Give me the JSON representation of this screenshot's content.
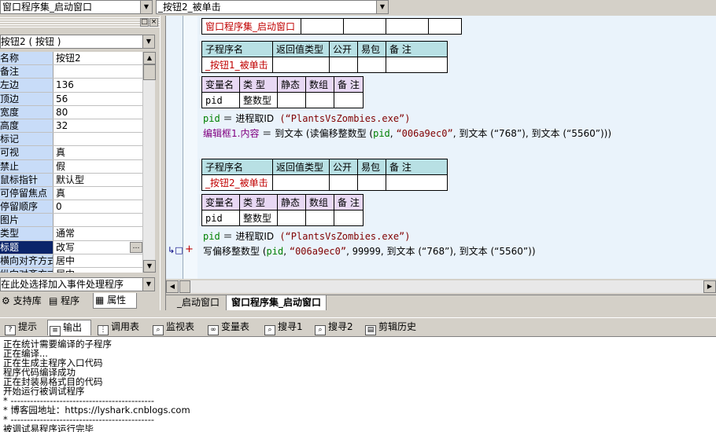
{
  "top": {
    "class_combo": "窗口程序集_启动窗口",
    "sub_combo": "_按钮2_被单击"
  },
  "left": {
    "object_combo": "按钮2 ( 按钮 )",
    "props": [
      {
        "name": "名称",
        "value": "按钮2"
      },
      {
        "name": "备注",
        "value": ""
      },
      {
        "name": "左边",
        "value": "136"
      },
      {
        "name": "顶边",
        "value": "56"
      },
      {
        "name": "宽度",
        "value": "80"
      },
      {
        "name": "高度",
        "value": "32"
      },
      {
        "name": "标记",
        "value": ""
      },
      {
        "name": "可视",
        "value": "真"
      },
      {
        "name": "禁止",
        "value": "假"
      },
      {
        "name": "鼠标指针",
        "value": "默认型"
      },
      {
        "name": "可停留焦点",
        "value": "真"
      },
      {
        "name": "停留顺序",
        "value": "0"
      },
      {
        "name": "图片",
        "value": ""
      },
      {
        "name": "类型",
        "value": "通常"
      },
      {
        "name": "标题",
        "value": "改写"
      },
      {
        "name": "横向对齐方式",
        "value": "居中"
      },
      {
        "name": "纵向对齐方式",
        "value": "居中"
      }
    ],
    "event_combo": "在此处选择加入事件处理程序",
    "tabs": {
      "lib": "支持库",
      "prog": "程序",
      "prop": "属性"
    }
  },
  "editor": {
    "class_name": "窗口程序集_启动窗口",
    "sub_headers": {
      "name": "子程序名",
      "ret": "返回值类型",
      "pub": "公开",
      "easy": "易包",
      "note": "备 注"
    },
    "var_headers": {
      "name": "变量名",
      "type": "类 型",
      "static": "静态",
      "array": "数组",
      "note": "备 注"
    },
    "sub1": {
      "name": "_按钮1_被单击",
      "var_name": "pid",
      "var_type": "整数型",
      "line1": {
        "lhs": "pid",
        "op": " ＝ ",
        "fn": "进程取ID",
        "arg": " (“PlantsVsZombies.exe”)"
      },
      "line2": {
        "lhs": "编辑框1.内容",
        "op": " ＝ ",
        "fn": "到文本",
        "rest": " (读偏移整数型 (",
        "a1": "pid",
        "a2": "“006a9ec0”",
        "a3": "到文本 (“768”)",
        "a4": "到文本 (“5560”)"
      }
    },
    "sub2": {
      "name": "_按钮2_被单击",
      "var_name": "pid",
      "var_type": "整数型",
      "line1": {
        "lhs": "pid",
        "op": " ＝ ",
        "fn": "进程取ID",
        "arg": " (“PlantsVsZombies.exe”)"
      },
      "line2": {
        "fn": "写偏移整数型",
        "a1": "pid",
        "a2": "“006a9ec0”",
        "a3": "99999",
        "a4": "到文本 (“768”)",
        "a5": "到文本 (“5560”)"
      }
    },
    "tabs": {
      "t1": "_启动窗口",
      "t2": "窗口程序集_启动窗口"
    }
  },
  "bottom": {
    "tabs": {
      "hint": "提示",
      "output": "输出",
      "calltable": "调用表",
      "watch": "监视表",
      "vars": "变量表",
      "find1": "搜寻1",
      "find2": "搜寻2",
      "clip": "剪辑历史"
    },
    "output_lines": [
      "正在统计需要编译的子程序",
      "正在编译...",
      "正在生成主程序入口代码",
      "程序代码编译成功",
      "正在封装易格式目的代码",
      "开始运行被调试程序",
      "* --------------------------------------------",
      "* 博客园地址：https://lyshark.cnblogs.com",
      "* --------------------------------------------",
      "被调试易程序运行完毕"
    ]
  }
}
